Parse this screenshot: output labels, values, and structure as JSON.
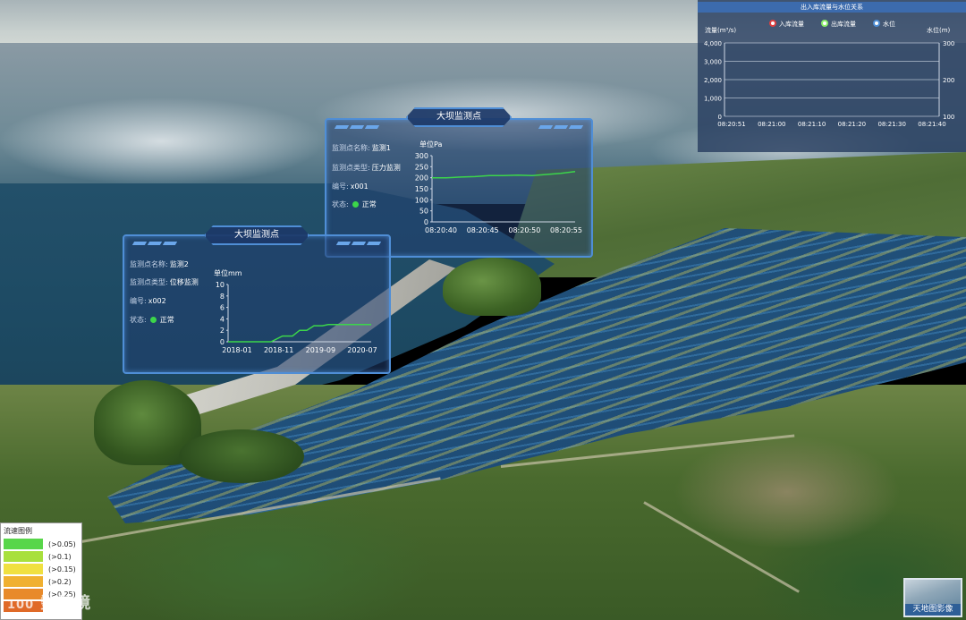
{
  "legend": {
    "title": "流速图例",
    "items": [
      {
        "label": "(>0.05)",
        "color": "#58d64a"
      },
      {
        "label": "(>0.1)",
        "color": "#a8e03c"
      },
      {
        "label": "(>0.15)",
        "color": "#f0e040"
      },
      {
        "label": "(>0.2)",
        "color": "#f0b030"
      },
      {
        "label": "(>0.25)",
        "color": "#e88a2a"
      },
      {
        "label": "",
        "color": "#e06a28"
      }
    ]
  },
  "watermark": "数跨境",
  "watermark_prefix": "100",
  "basemap_button": {
    "label": "天地图影像"
  },
  "panel1": {
    "title": "大坝监测点",
    "name_label": "监测点名称:",
    "name_value": "监测1",
    "type_label": "监测点类型:",
    "type_value": "压力监测",
    "id_label": "编号:",
    "id_value": "x001",
    "status_label": "状态:",
    "status_value": "正常",
    "status_color": "#3cd64a",
    "unit": "单位Pa"
  },
  "panel2": {
    "title": "大坝监测点",
    "name_label": "监测点名称:",
    "name_value": "监测2",
    "type_label": "监测点类型:",
    "type_value": "位移监测",
    "id_label": "编号:",
    "id_value": "x002",
    "status_label": "状态:",
    "status_value": "正常",
    "status_color": "#3cd64a",
    "unit": "单位mm"
  },
  "flow_panel": {
    "title": "出入库流量与水位关系",
    "left_axis": "流量(m³/s)",
    "right_axis": "水位(m)",
    "series_names": [
      "入库流量",
      "出库流量",
      "水位"
    ]
  },
  "chart_data": [
    {
      "type": "line",
      "title": "",
      "ylabel": "单位Pa",
      "x": [
        "08:20:40",
        "08:20:45",
        "08:20:50",
        "08:20:55"
      ],
      "ylim": [
        0,
        300
      ],
      "yticks": [
        0,
        50,
        100,
        150,
        200,
        250,
        300
      ],
      "series": [
        {
          "values_x": [
            0,
            0.1,
            0.2,
            0.3,
            0.4,
            0.5,
            0.6,
            0.7,
            0.8,
            0.9,
            1.0
          ],
          "values": [
            200,
            200,
            203,
            205,
            210,
            210,
            212,
            210,
            215,
            220,
            228
          ],
          "color": "#3cd64a"
        }
      ]
    },
    {
      "type": "line",
      "title": "",
      "ylabel": "单位mm",
      "x": [
        "2018-01",
        "2018-11",
        "2019-09",
        "2020-07"
      ],
      "ylim": [
        0,
        10
      ],
      "yticks": [
        0,
        2,
        4,
        6,
        8,
        10
      ],
      "series": [
        {
          "values_x": [
            0,
            0.3,
            0.38,
            0.45,
            0.5,
            0.55,
            0.6,
            0.66,
            0.7,
            1.0
          ],
          "values": [
            0,
            0,
            1,
            1,
            2,
            2,
            2.8,
            2.8,
            3,
            3
          ],
          "color": "#3cd64a"
        }
      ]
    },
    {
      "type": "line",
      "title": "出入库流量与水位关系",
      "ylabel": "流量(m³/s)",
      "y2label": "水位(m)",
      "x": [
        "08:20:51",
        "08:21:00",
        "08:21:10",
        "08:21:20",
        "08:21:30",
        "08:21:40"
      ],
      "ylim": [
        0,
        4000
      ],
      "yticks": [
        0,
        1000,
        2000,
        3000,
        4000
      ],
      "y2lim": [
        100,
        300
      ],
      "y2ticks": [
        100,
        200,
        300
      ],
      "series": [
        {
          "name": "入库流量",
          "color": "#ffffff",
          "values": []
        },
        {
          "name": "出库流量",
          "color": "#8cf06a",
          "values": []
        },
        {
          "name": "水位",
          "color": "#4f8ed6",
          "values": []
        }
      ],
      "grid": true,
      "legend": "top"
    }
  ]
}
